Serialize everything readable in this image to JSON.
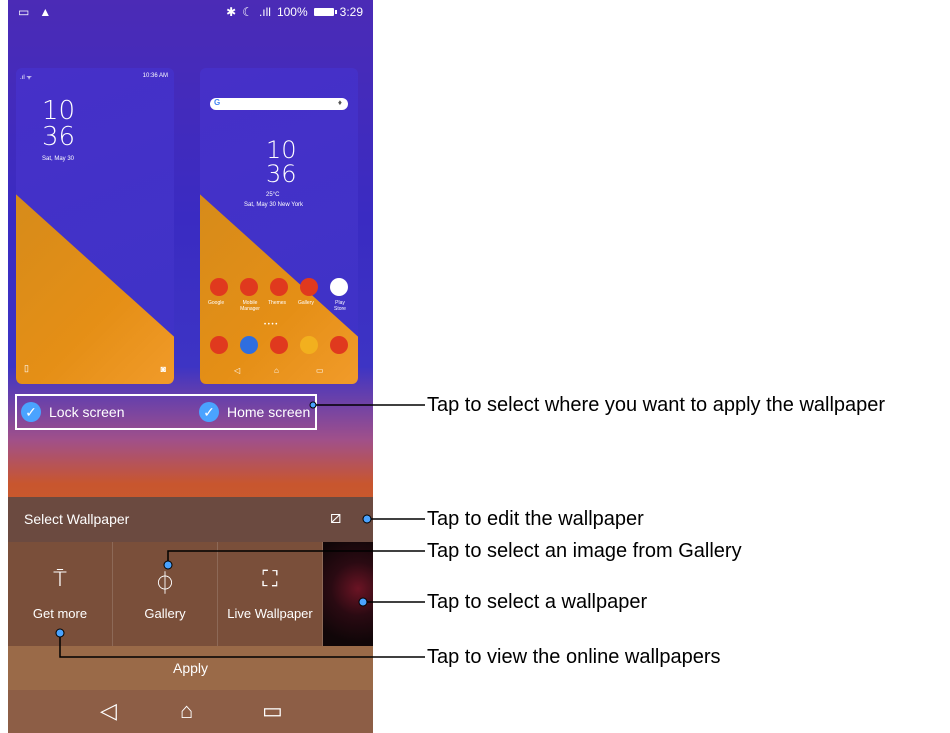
{
  "status_bar": {
    "time": "3:29",
    "battery": "100%",
    "left_icons": [
      "image-icon",
      "warning-icon"
    ],
    "right_icons": [
      "bluetooth-icon",
      "alarm-icon",
      "signal-icon"
    ]
  },
  "lock_preview": {
    "status_time": "10:36 AM",
    "hour": "10",
    "minute": "36",
    "date": "Sat, May 30"
  },
  "home_preview": {
    "hour": "10",
    "minute": "36",
    "weather": "25°C",
    "date_location": "Sat, May 30  New York",
    "apps": [
      "Google",
      "Mobile Manager",
      "Themes",
      "Gallery",
      "Play Store"
    ]
  },
  "apply_to": {
    "lock_label": "Lock screen",
    "home_label": "Home screen"
  },
  "sheet": {
    "title": "Select Wallpaper",
    "tiles": [
      {
        "label": "Get more",
        "icon": "paint-roller-icon"
      },
      {
        "label": "Gallery",
        "icon": "balloon-icon"
      },
      {
        "label": "Live Wallpaper",
        "icon": "live-wallpaper-icon"
      }
    ],
    "apply_label": "Apply"
  },
  "callouts": {
    "apply_location": "Tap to select where you want to apply the wallpaper",
    "edit": "Tap to edit the wallpaper",
    "gallery": "Tap to select an image from Gallery",
    "select": "Tap to select a wallpaper",
    "online": "Tap to view the online wallpapers"
  }
}
